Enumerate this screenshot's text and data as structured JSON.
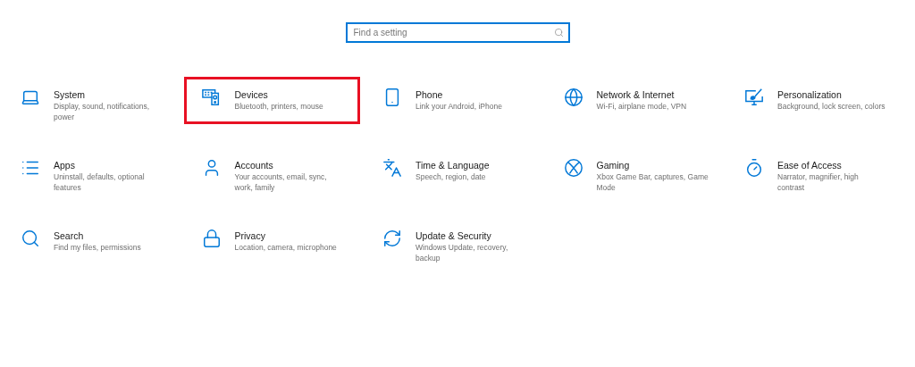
{
  "search": {
    "placeholder": "Find a setting"
  },
  "categories": [
    {
      "title": "System",
      "subtitle_lines": [
        "Display, sound, notifications,",
        "power"
      ],
      "highlighted": false
    },
    {
      "title": "Devices",
      "subtitle_lines": [
        "Bluetooth, printers, mouse"
      ],
      "highlighted": true
    },
    {
      "title": "Phone",
      "subtitle_lines": [
        "Link your Android, iPhone"
      ],
      "highlighted": false
    },
    {
      "title": "Network & Internet",
      "subtitle_lines": [
        "Wi-Fi, airplane mode, VPN"
      ],
      "highlighted": false
    },
    {
      "title": "Personalization",
      "subtitle_lines": [
        "Background, lock screen, colors"
      ],
      "highlighted": false
    },
    {
      "title": "Apps",
      "subtitle_lines": [
        "Uninstall, defaults, optional",
        "features"
      ],
      "highlighted": false
    },
    {
      "title": "Accounts",
      "subtitle_lines": [
        "Your accounts, email, sync,",
        "work, family"
      ],
      "highlighted": false
    },
    {
      "title": "Time & Language",
      "subtitle_lines": [
        "Speech, region, date"
      ],
      "highlighted": false
    },
    {
      "title": "Gaming",
      "subtitle_lines": [
        "Xbox Game Bar, captures, Game",
        "Mode"
      ],
      "highlighted": false
    },
    {
      "title": "Ease of Access",
      "subtitle_lines": [
        "Narrator, magnifier, high",
        "contrast"
      ],
      "highlighted": false
    },
    {
      "title": "Search",
      "subtitle_lines": [
        "Find my files, permissions"
      ],
      "highlighted": false
    },
    {
      "title": "Privacy",
      "subtitle_lines": [
        "Location, camera, microphone"
      ],
      "highlighted": false
    },
    {
      "title": "Update & Security",
      "subtitle_lines": [
        "Windows Update, recovery,",
        "backup"
      ],
      "highlighted": false
    }
  ]
}
